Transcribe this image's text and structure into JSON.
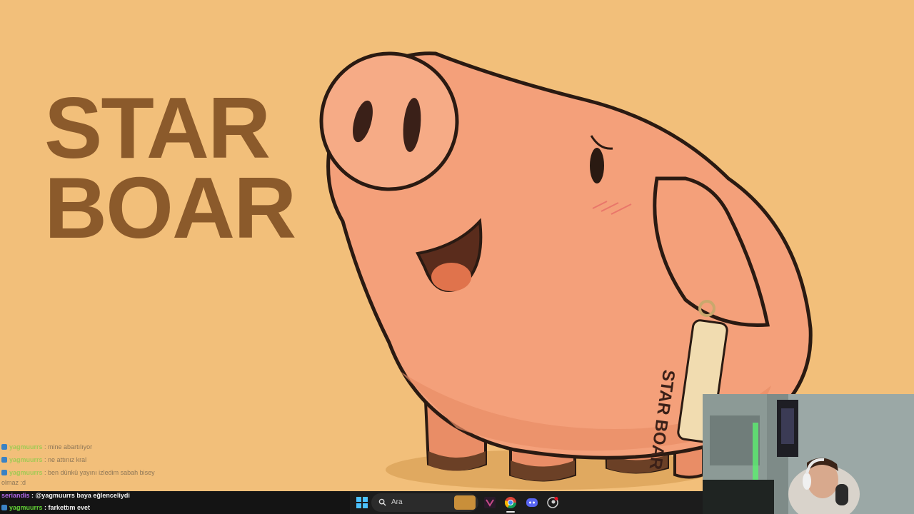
{
  "stream_overlay": {
    "title_line1": "STAR",
    "title_line2": "BOAR",
    "tag_text": "STAR BOAR"
  },
  "chat": {
    "messages": [
      {
        "user": "yagmuurrs",
        "text": "mine abartılıyor"
      },
      {
        "user": "yagmuurrs",
        "text": "ne attınız kral"
      },
      {
        "user": "yagmuurrs",
        "text": "ben dünkü yayını izledim sabah bisey"
      },
      {
        "user": "",
        "text": "olmaz :d"
      },
      {
        "user": "seriandis",
        "text": "@yagmuurrs baya eğlenceliydi"
      },
      {
        "user": "yagmuurrs",
        "text": "farkettım evet"
      }
    ]
  },
  "taskbar": {
    "search_placeholder": "Ara",
    "icons": [
      "windows-start-icon",
      "search-icon",
      "widget-icon",
      "visual-studio-icon",
      "chrome-icon",
      "discord-icon",
      "steam-icon"
    ]
  },
  "colors": {
    "background": "#f2bf7a",
    "title": "#8b5a2b",
    "pig_body": "#f4a07a",
    "outline": "#2a1a12",
    "taskbar": "#1c1c1c",
    "chat_user": "#63d236",
    "chat_user_alt": "#b066e6"
  }
}
